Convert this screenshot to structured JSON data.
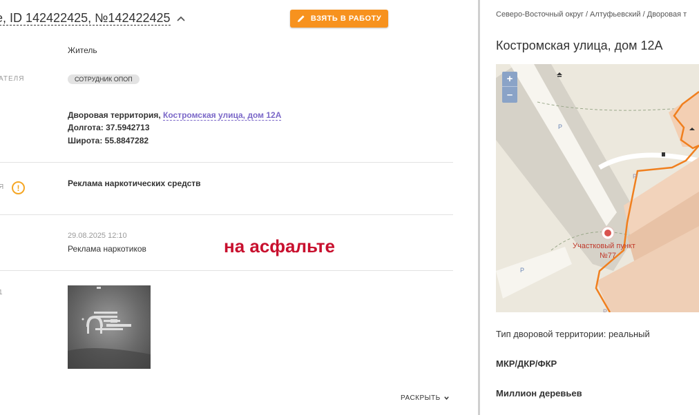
{
  "header": {
    "title": "e, ID 142422425, №142422425",
    "take_button": "ВЗЯТЬ В РАБОТУ"
  },
  "fields": {
    "author_value": "Житель",
    "role_label_tail": "АТЕЛЯ",
    "role_chip": "СОТРУДНИК ОПОП",
    "location_prefix": "Дворовая территория,",
    "location_link": "Костромская улица, дом 12А",
    "longitude": "Долгота: 37.5942713",
    "latitude": "Широта: 55.8847282",
    "category_label_tail": "Я",
    "category_value": "Реклама наркотических средств",
    "comment_date": "29.08.2025 12:10",
    "comment_text": "Реклама наркотиков",
    "photo_label_tail": "1",
    "overlay_note": "на асфальте",
    "expand_label": "РАСКРЫТЬ"
  },
  "right": {
    "breadcrumb": "Северо-Восточный округ / Алтуфьевский / Дворовая т",
    "address": "Костромская улица, дом 12А",
    "map": {
      "zoom_in": "+",
      "zoom_out": "–",
      "poi_label": "Участковый пункт",
      "poi_number": "№77",
      "parking": "P"
    },
    "territory_type": "Тип дворовой территории: реальный",
    "program_1": "МКР/ДКР/ФКР",
    "program_2": "Миллион деревьев"
  },
  "colors": {
    "accent": "#f7921e",
    "link": "#7b68c8",
    "overlay_text": "#c8102e",
    "map_border": "#f07f1e"
  }
}
